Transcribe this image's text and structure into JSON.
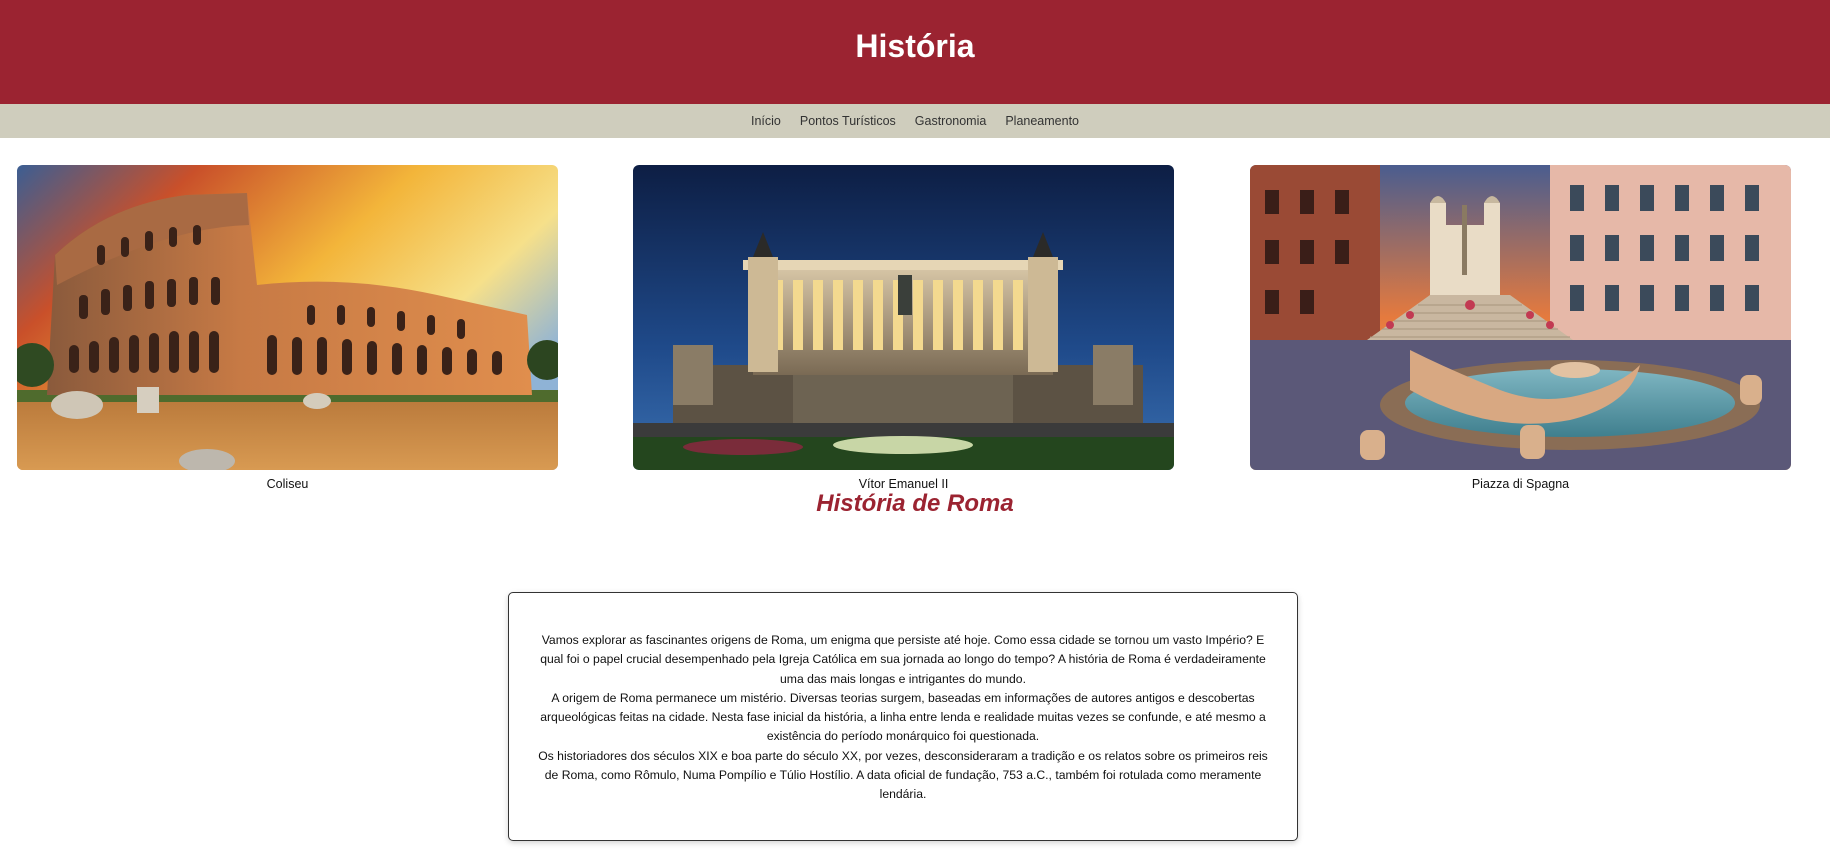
{
  "header": {
    "title": "História"
  },
  "nav": {
    "items": [
      {
        "label": "Início"
      },
      {
        "label": "Pontos Turísticos"
      },
      {
        "label": "Gastronomia"
      },
      {
        "label": "Planeamento"
      }
    ]
  },
  "gallery": {
    "items": [
      {
        "caption": "Coliseu",
        "image": "colosseum-photo"
      },
      {
        "caption": "Vítor Emanuel II",
        "image": "vittoriano-monument-photo"
      },
      {
        "caption": "Piazza di Spagna",
        "image": "spanish-steps-fountain-photo"
      }
    ]
  },
  "section": {
    "title": "História de Roma",
    "paragraphs": [
      "Vamos explorar as fascinantes origens de Roma, um enigma que persiste até hoje. Como essa cidade se tornou um vasto Império? E qual foi o papel crucial desempenhado pela Igreja Católica em sua jornada ao longo do tempo? A história de Roma é verdadeiramente uma das mais longas e intrigantes do mundo.",
      "A origem de Roma permanece um mistério. Diversas teorias surgem, baseadas em informações de autores antigos e descobertas arqueológicas feitas na cidade. Nesta fase inicial da história, a linha entre lenda e realidade muitas vezes se confunde, e até mesmo a existência do período monárquico foi questionada.",
      "Os historiadores dos séculos XIX e boa parte do século XX, por vezes, desconsideraram a tradição e os relatos sobre os primeiros reis de Roma, como Rômulo, Numa Pompílio e Túlio Hostílio. A data oficial de fundação, 753 a.C., também foi rotulada como meramente lendária."
    ]
  },
  "colors": {
    "header_bg": "#9b2331",
    "nav_bg": "#cfcdbd",
    "accent": "#9b2331"
  }
}
